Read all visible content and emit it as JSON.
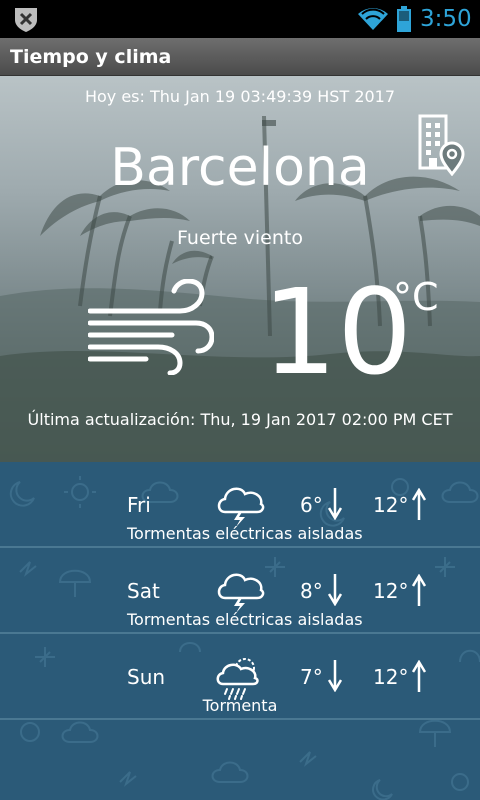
{
  "status_bar": {
    "time": "3:50"
  },
  "app_bar": {
    "title": "Tiempo y clima"
  },
  "current": {
    "today": "Hoy es: Thu Jan 19 03:49:39 HST 2017",
    "city": "Barcelona",
    "condition": "Fuerte viento",
    "temperature": "10",
    "unit": "°C",
    "last_update": "Última actualización: Thu, 19 Jan 2017 02:00 PM CET"
  },
  "forecast": [
    {
      "day": "Fri",
      "icon": "thunderstorm-icon",
      "low": "6°",
      "high": "12°",
      "description": "Tormentas eléctricas aisladas"
    },
    {
      "day": "Sat",
      "icon": "thunderstorm-icon",
      "low": "8°",
      "high": "12°",
      "description": "Tormentas eléctricas aisladas"
    },
    {
      "day": "Sun",
      "icon": "storm-rain-icon",
      "low": "7°",
      "high": "12°",
      "description": "Tormenta"
    }
  ],
  "colors": {
    "accent_time": "#2ea4d8",
    "forecast_bg": "#2b5a78",
    "app_bar": "#5a5a5a"
  }
}
